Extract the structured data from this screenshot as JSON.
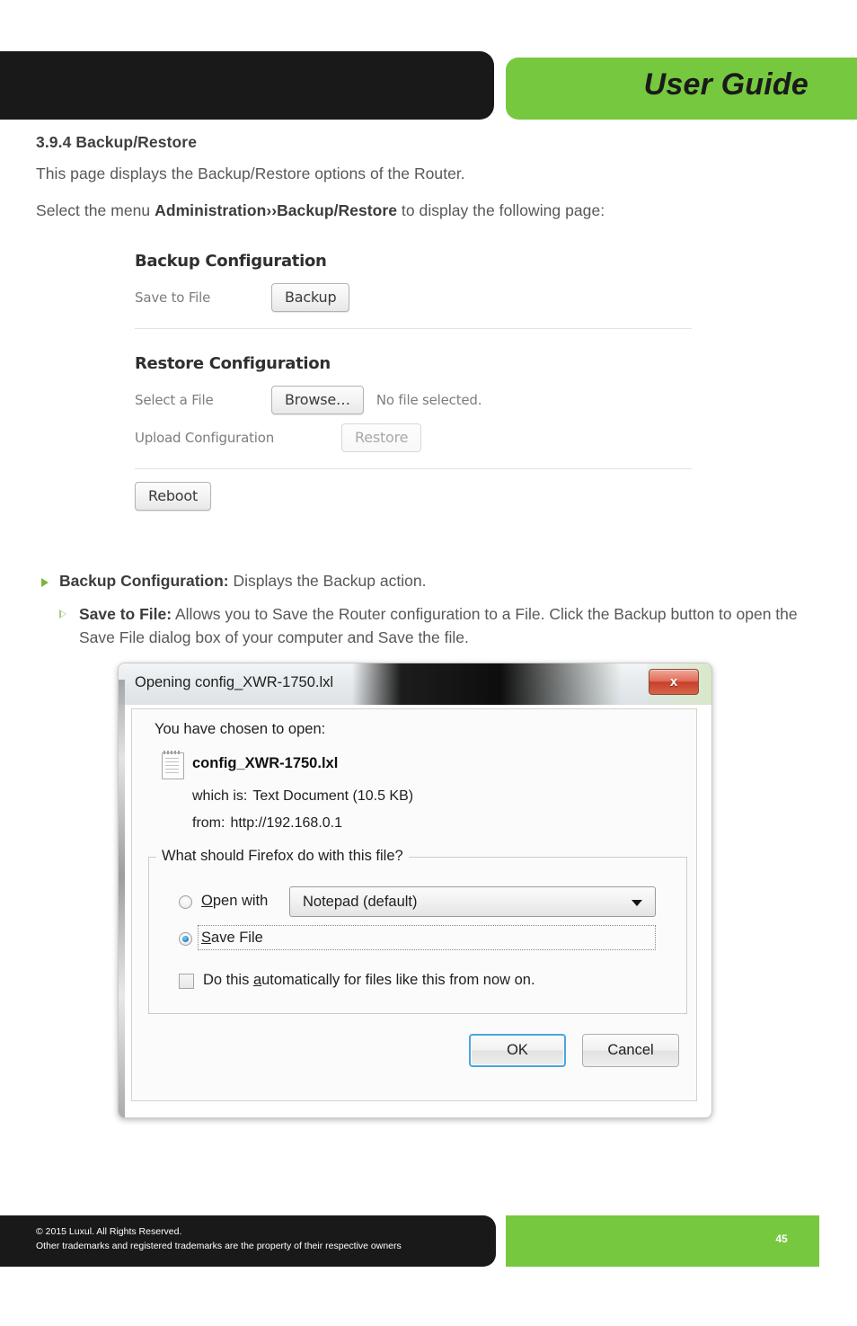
{
  "header": {
    "title": "User Guide"
  },
  "doc": {
    "section_heading": "3.9.4 Backup/Restore",
    "paragraph_1": "This page displays the Backup/Restore options of the Router.",
    "paragraph_2_prefix": "Select the menu ",
    "paragraph_2_bold": "Administration››Backup/Restore",
    "paragraph_2_suffix": " to display the following page:"
  },
  "router_screenshot": {
    "backup_section_title": "Backup Configuration",
    "save_to_file_label": "Save to File",
    "backup_button": "Backup",
    "restore_section_title": "Restore Configuration",
    "select_a_file_label": "Select a File",
    "browse_button": "Browse…",
    "no_file_selected": "No file selected.",
    "upload_configuration_label": "Upload Configuration",
    "restore_button": "Restore",
    "reboot_button": "Reboot"
  },
  "bullets": {
    "item1_bold": "Backup Configuration:",
    "item1_text": " Displays the Backup action.",
    "item2_bold": "Save to File:",
    "item2_text": " Allows you to Save the Router configuration to a File. Click the Backup button to open the Save File dialog box of your computer and Save the file."
  },
  "dialog": {
    "title": "Opening config_XWR-1750.lxl",
    "close_label": "x",
    "chosen_label": "You have chosen to open:",
    "filename": "config_XWR-1750.lxl",
    "which_is_key": "which is:",
    "which_is_value": "Text Document (10.5 KB)",
    "from_key": "from:",
    "from_value": "http://192.168.0.1",
    "fieldset_legend": "What should Firefox do with this file?",
    "open_with_label_u": "O",
    "open_with_label_rest": "pen with",
    "open_with_value": "Notepad (default)",
    "save_file_label_u": "S",
    "save_file_label_rest": "ave File",
    "checkbox_label_pre": "Do this ",
    "checkbox_label_u": "a",
    "checkbox_label_post": "utomatically for files like this from now on.",
    "ok_button": "OK",
    "cancel_button": "Cancel"
  },
  "footer": {
    "line1": "© 2015  Luxul. All Rights Reserved.",
    "line2": "Other trademarks and registered trademarks are the property of their respective owners",
    "page_number": "45"
  },
  "colors": {
    "brand_green": "#76c83f",
    "brand_black": "#191919",
    "body_text": "#58585a",
    "bullet_green": "#7eb53e"
  }
}
